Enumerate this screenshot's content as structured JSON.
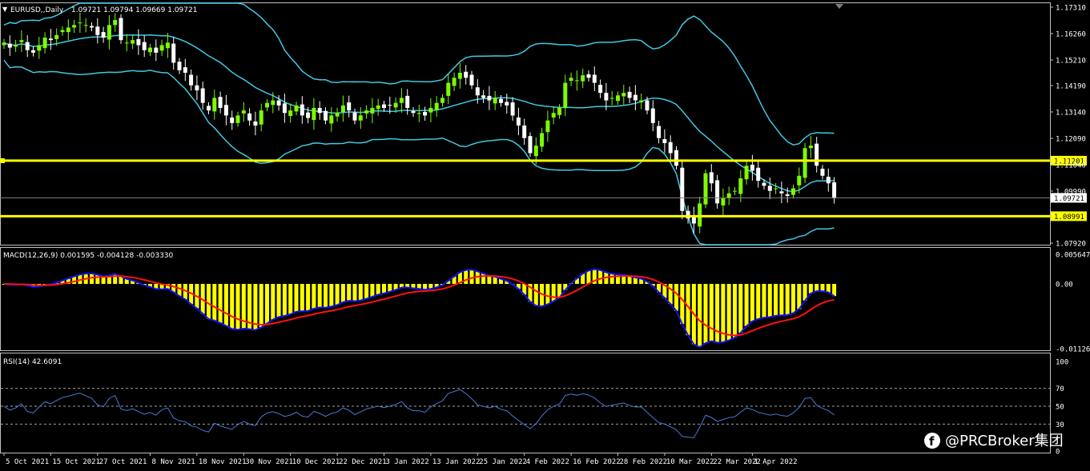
{
  "header": {
    "symbol_label": "EURUSD,,Daily",
    "ohlc": "1.09721 1.09794 1.09669 1.09721"
  },
  "colors": {
    "background": "#000000",
    "bull_candle": "#7CFC00",
    "bear_candle": "#ffffff",
    "bollinger": "#40c8e0",
    "level_line": "#ffff00",
    "macd_hist": "#ffff00",
    "macd_main": "#1010ff",
    "macd_signal": "#ff1010",
    "rsi": "#4a7ad0",
    "grid_text": "#ffffff"
  },
  "main_panel": {
    "price_axis": [
      "1.17310",
      "1.16260",
      "1.15210",
      "1.14190",
      "1.13140",
      "1.12090",
      "1.11040",
      "1.09990",
      "1.07920"
    ],
    "levels": [
      {
        "label": "1.11201",
        "value": 1.11201
      },
      {
        "label": "1.08991",
        "value": 1.08991
      }
    ],
    "current_price_label": "1.09721",
    "current_price": 1.09721
  },
  "macd_panel": {
    "title": "MACD(12,26,9) 0.001595 -0.004128 -0.003330",
    "axis": [
      "0.005647",
      "0.00",
      "-0.011265"
    ]
  },
  "rsi_panel": {
    "title": "RSI(14) 42.6091",
    "axis": [
      "100",
      "70",
      "50",
      "30",
      "0"
    ]
  },
  "date_axis": [
    "5 Oct 2021",
    "15 Oct 2021",
    "27 Oct 2021",
    "8 Nov 2021",
    "18 Nov 2021",
    "30 Nov 2021",
    "10 Dec 2021",
    "22 Dec 2021",
    "3 Jan 2022",
    "13 Jan 2022",
    "25 Jan 2022",
    "4 Feb 2022",
    "16 Feb 2022",
    "28 Feb 2022",
    "10 Mar 2022",
    "22 Mar 2022",
    "1 Apr 2022"
  ],
  "watermark": "@PRCBroker集团",
  "chart_data": {
    "type": "candlestick",
    "title": "EURUSD,,Daily",
    "ylim": [
      1.0765,
      1.1742
    ],
    "approximate_close": [
      1.159,
      1.157,
      1.158,
      1.16,
      1.156,
      1.155,
      1.158,
      1.161,
      1.16,
      1.162,
      1.164,
      1.165,
      1.166,
      1.167,
      1.166,
      1.165,
      1.162,
      1.161,
      1.166,
      1.168,
      1.16,
      1.159,
      1.16,
      1.158,
      1.156,
      1.157,
      1.155,
      1.158,
      1.159,
      1.151,
      1.148,
      1.147,
      1.142,
      1.14,
      1.135,
      1.132,
      1.137,
      1.133,
      1.13,
      1.127,
      1.13,
      1.132,
      1.128,
      1.126,
      1.132,
      1.135,
      1.136,
      1.134,
      1.131,
      1.132,
      1.134,
      1.13,
      1.129,
      1.133,
      1.131,
      1.128,
      1.13,
      1.131,
      1.134,
      1.132,
      1.128,
      1.13,
      1.132,
      1.133,
      1.134,
      1.133,
      1.134,
      1.135,
      1.137,
      1.133,
      1.131,
      1.131,
      1.13,
      1.133,
      1.135,
      1.137,
      1.143,
      1.145,
      1.147,
      1.145,
      1.142,
      1.138,
      1.137,
      1.136,
      1.137,
      1.135,
      1.134,
      1.13,
      1.126,
      1.121,
      1.115,
      1.118,
      1.123,
      1.128,
      1.131,
      1.133,
      1.143,
      1.145,
      1.144,
      1.146,
      1.145,
      1.143,
      1.139,
      1.136,
      1.137,
      1.138,
      1.139,
      1.137,
      1.136,
      1.136,
      1.132,
      1.127,
      1.121,
      1.119,
      1.115,
      1.11,
      1.092,
      1.089,
      1.087,
      1.095,
      1.107,
      1.103,
      1.095,
      1.097,
      1.099,
      1.1,
      1.105,
      1.11,
      1.108,
      1.104,
      1.102,
      1.1,
      1.101,
      1.099,
      1.098,
      1.101,
      1.106,
      1.117,
      1.118,
      1.11,
      1.106,
      1.103,
      1.097
    ]
  }
}
